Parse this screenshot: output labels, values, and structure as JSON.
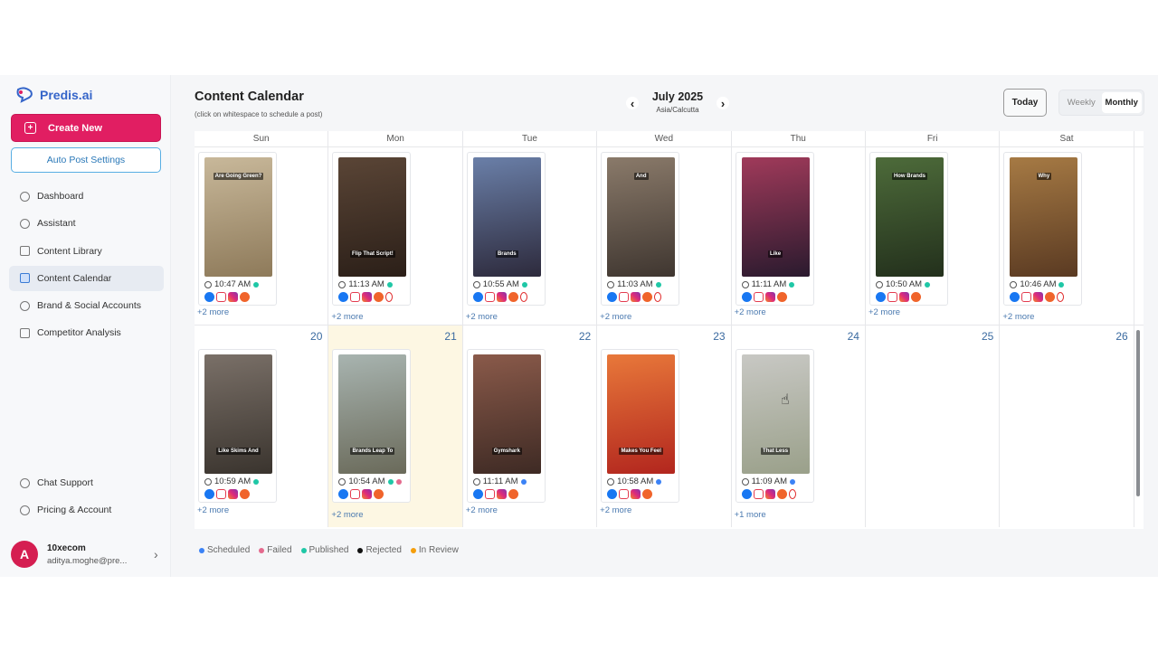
{
  "app": {
    "logo_text": "Predis.ai"
  },
  "sidebar": {
    "create_label": "Create New",
    "autopost_label": "Auto Post Settings",
    "nav": [
      {
        "label": "Dashboard",
        "icon": "home-icon"
      },
      {
        "label": "Assistant",
        "icon": "sparkle-icon"
      },
      {
        "label": "Content Library",
        "icon": "folder-icon"
      },
      {
        "label": "Content Calendar",
        "icon": "calendar-icon",
        "active": true
      },
      {
        "label": "Brand & Social Accounts",
        "icon": "at-icon"
      },
      {
        "label": "Competitor Analysis",
        "icon": "bar-chart-icon"
      }
    ],
    "bottom_nav": [
      {
        "label": "Chat Support",
        "icon": "help-icon"
      },
      {
        "label": "Pricing & Account",
        "icon": "settings-icon"
      }
    ],
    "user": {
      "avatar_letter": "A",
      "name": "10xecom",
      "email": "aditya.moghe@pre..."
    }
  },
  "header": {
    "title": "Content Calendar",
    "subtitle": "(click on whitespace to schedule a post)",
    "month": "July 2025",
    "timezone": "Asia/Calcutta",
    "today_label": "Today",
    "view_options": [
      "Weekly",
      "Monthly"
    ],
    "active_view": "Monthly"
  },
  "calendar": {
    "weekdays": [
      "Sun",
      "Mon",
      "Tue",
      "Wed",
      "Thu",
      "Fri",
      "Sat"
    ],
    "row1": [
      {
        "day": "",
        "post": {
          "time": "10:47 AM",
          "status": "published",
          "caption": "Are Going Green?",
          "cap_pos": "top",
          "bg": [
            "#c8b89a",
            "#8e7a5a"
          ],
          "icons": [
            "fb",
            "rd",
            "ig",
            "pl"
          ]
        },
        "more": "+2 more"
      },
      {
        "day": "",
        "post": {
          "time": "11:13 AM",
          "status": "published",
          "caption": "Flip That Script!",
          "cap_pos": "bottom",
          "bg": [
            "#5a4536",
            "#2b1f18"
          ],
          "icons": [
            "fb",
            "rd",
            "ig",
            "pl",
            "yt"
          ]
        },
        "more": "+2 more"
      },
      {
        "day": "",
        "post": {
          "time": "10:55 AM",
          "status": "published",
          "caption": "Brands",
          "cap_pos": "bottom",
          "bg": [
            "#6a7fa8",
            "#2d2a3c"
          ],
          "icons": [
            "fb",
            "rd",
            "ig",
            "pl",
            "yt"
          ]
        },
        "more": "+2 more"
      },
      {
        "day": "",
        "post": {
          "time": "11:03 AM",
          "status": "published",
          "caption": "And",
          "cap_pos": "top",
          "bg": [
            "#8a7a6a",
            "#3f3630"
          ],
          "icons": [
            "fb",
            "rd",
            "ig",
            "pl",
            "yt"
          ]
        },
        "more": "+2 more"
      },
      {
        "day": "",
        "post": {
          "time": "11:11 AM",
          "status": "published",
          "caption": "Like",
          "cap_pos": "bottom",
          "bg": [
            "#a03a5a",
            "#2a1a2e"
          ],
          "icons": [
            "fb",
            "rd",
            "ig",
            "pl"
          ]
        },
        "more": "+2 more"
      },
      {
        "day": "",
        "post": {
          "time": "10:50 AM",
          "status": "published",
          "caption": "How Brands",
          "cap_pos": "top",
          "bg": [
            "#4d6b3a",
            "#23301c"
          ],
          "icons": [
            "fb",
            "rd",
            "ig",
            "pl"
          ]
        },
        "more": "+2 more"
      },
      {
        "day": "",
        "post": {
          "time": "10:46 AM",
          "status": "published",
          "caption": "Why",
          "cap_pos": "top",
          "bg": [
            "#a67a44",
            "#5a3a22"
          ],
          "icons": [
            "fb",
            "rd",
            "ig",
            "pl",
            "yt"
          ]
        },
        "more": "+2 more"
      }
    ],
    "row2": [
      {
        "day": "20",
        "post": {
          "time": "10:59 AM",
          "status": "published",
          "caption": "Like Skims And",
          "cap_pos": "bottom",
          "bg": [
            "#7a7068",
            "#3a342e"
          ],
          "icons": [
            "fb",
            "rd",
            "ig",
            "pl"
          ]
        },
        "more": "+2 more"
      },
      {
        "day": "21",
        "today": true,
        "post": {
          "time": "10:54 AM",
          "status": "published",
          "status2": "failed",
          "caption": "Brands Leap To",
          "cap_pos": "bottom",
          "bg": [
            "#a8b4b0",
            "#6a6a5a"
          ],
          "icons": [
            "fb",
            "rd",
            "ig",
            "pl"
          ]
        },
        "more": "+2 more"
      },
      {
        "day": "22",
        "post": {
          "time": "11:11 AM",
          "status": "scheduled",
          "caption": "Gymshark",
          "cap_pos": "bottom",
          "bg": [
            "#8a5a4a",
            "#3e2a24"
          ],
          "icons": [
            "fb",
            "rd",
            "ig",
            "pl"
          ]
        },
        "more": "+2 more"
      },
      {
        "day": "23",
        "post": {
          "time": "10:58 AM",
          "status": "scheduled",
          "caption": "Makes You Feel",
          "cap_pos": "bottom",
          "bg": [
            "#e8783a",
            "#b2261e"
          ],
          "icons": [
            "fb",
            "rd",
            "ig",
            "pl"
          ]
        },
        "more": "+2 more"
      },
      {
        "day": "24",
        "post": {
          "time": "11:09 AM",
          "status": "scheduled",
          "caption": "That Less",
          "cap_pos": "bottom",
          "bg": [
            "#c8c8c4",
            "#9aa08a"
          ],
          "icons": [
            "fb",
            "rd",
            "ig",
            "pl",
            "yt"
          ]
        },
        "more": "+1 more"
      },
      {
        "day": "25"
      },
      {
        "day": "26"
      }
    ]
  },
  "legend": [
    {
      "label": "Scheduled",
      "color": "#3b82f6"
    },
    {
      "label": "Failed",
      "color": "#e46a8e"
    },
    {
      "label": "Published",
      "color": "#1fc7a6"
    },
    {
      "label": "Rejected",
      "color": "#111111"
    },
    {
      "label": "In Review",
      "color": "#f59e0b"
    }
  ],
  "status_colors": {
    "published": "#1fc7a6",
    "scheduled": "#3b82f6",
    "failed": "#e46a8e"
  }
}
